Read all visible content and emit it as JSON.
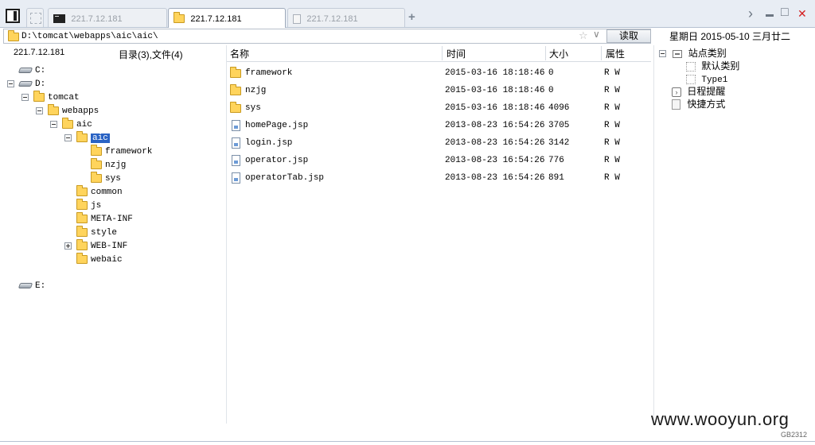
{
  "tabs": [
    {
      "label": "221.7.12.181",
      "icon": "terminal-icon",
      "active": false
    },
    {
      "label": "221.7.12.181",
      "icon": "folder-icon",
      "active": true
    },
    {
      "label": "221.7.12.181",
      "icon": "document-icon",
      "active": false
    }
  ],
  "new_tab_label": "+",
  "window_controls": {
    "nav": "›",
    "minimize": "▬",
    "maximize": "□",
    "close": "✕"
  },
  "address": {
    "value": "D:\\tomcat\\webapps\\aic\\aic\\",
    "star": "☆",
    "dropdown": "∨",
    "read_button": "读取"
  },
  "date_label": "星期日 2015-05-10 三月廿二",
  "left": {
    "host": "221.7.12.181",
    "summary": "目录(3),文件(4)",
    "tree": [
      {
        "label": "C:",
        "kind": "drive",
        "indent": 0,
        "expander": "none"
      },
      {
        "label": "D:",
        "kind": "drive",
        "indent": 0,
        "expander": "minus"
      },
      {
        "label": "tomcat",
        "kind": "folder",
        "indent": 1,
        "expander": "minus"
      },
      {
        "label": "webapps",
        "kind": "folder",
        "indent": 2,
        "expander": "minus"
      },
      {
        "label": "aic",
        "kind": "folder",
        "indent": 3,
        "expander": "minus"
      },
      {
        "label": "aic",
        "kind": "folder",
        "indent": 4,
        "expander": "minus",
        "selected": true
      },
      {
        "label": "framework",
        "kind": "folder",
        "indent": 5,
        "expander": "none"
      },
      {
        "label": "nzjg",
        "kind": "folder",
        "indent": 5,
        "expander": "none"
      },
      {
        "label": "sys",
        "kind": "folder",
        "indent": 5,
        "expander": "none"
      },
      {
        "label": "common",
        "kind": "folder",
        "indent": 4,
        "expander": "none"
      },
      {
        "label": "js",
        "kind": "folder",
        "indent": 4,
        "expander": "none"
      },
      {
        "label": "META-INF",
        "kind": "folder",
        "indent": 4,
        "expander": "none"
      },
      {
        "label": "style",
        "kind": "folder",
        "indent": 4,
        "expander": "none"
      },
      {
        "label": "WEB-INF",
        "kind": "folder",
        "indent": 4,
        "expander": "plus"
      },
      {
        "label": "webaic",
        "kind": "folder",
        "indent": 4,
        "expander": "none"
      },
      {
        "label": "E:",
        "kind": "drive",
        "indent": 0,
        "expander": "none",
        "gap": true
      }
    ]
  },
  "list": {
    "columns": [
      "名称",
      "时间",
      "大小",
      "属性"
    ],
    "rows": [
      {
        "name": "framework",
        "type": "folder",
        "time": "2015-03-16 18:18:46",
        "size": "0",
        "attr": "R W"
      },
      {
        "name": "nzjg",
        "type": "folder",
        "time": "2015-03-16 18:18:46",
        "size": "0",
        "attr": "R W"
      },
      {
        "name": "sys",
        "type": "folder",
        "time": "2015-03-16 18:18:46",
        "size": "4096",
        "attr": "R W"
      },
      {
        "name": "homePage.jsp",
        "type": "file",
        "time": "2013-08-23 16:54:26",
        "size": "3705",
        "attr": "R W"
      },
      {
        "name": "login.jsp",
        "type": "file",
        "time": "2013-08-23 16:54:26",
        "size": "3142",
        "attr": "R W"
      },
      {
        "name": "operator.jsp",
        "type": "file",
        "time": "2013-08-23 16:54:26",
        "size": "776",
        "attr": "R W"
      },
      {
        "name": "operatorTab.jsp",
        "type": "file",
        "time": "2013-08-23 16:54:26",
        "size": "891",
        "attr": "R W"
      }
    ]
  },
  "right": {
    "site_category": "站点类别",
    "categories": [
      "默认类别",
      "Type1"
    ],
    "reminder": "日程提醒",
    "shortcut": "快捷方式"
  },
  "watermark": "www.wooyun.org",
  "watermark_code": "GB2312",
  "colors": {
    "accent": "#2a63c4",
    "folder": "#ffd45c",
    "close": "#d42020"
  }
}
